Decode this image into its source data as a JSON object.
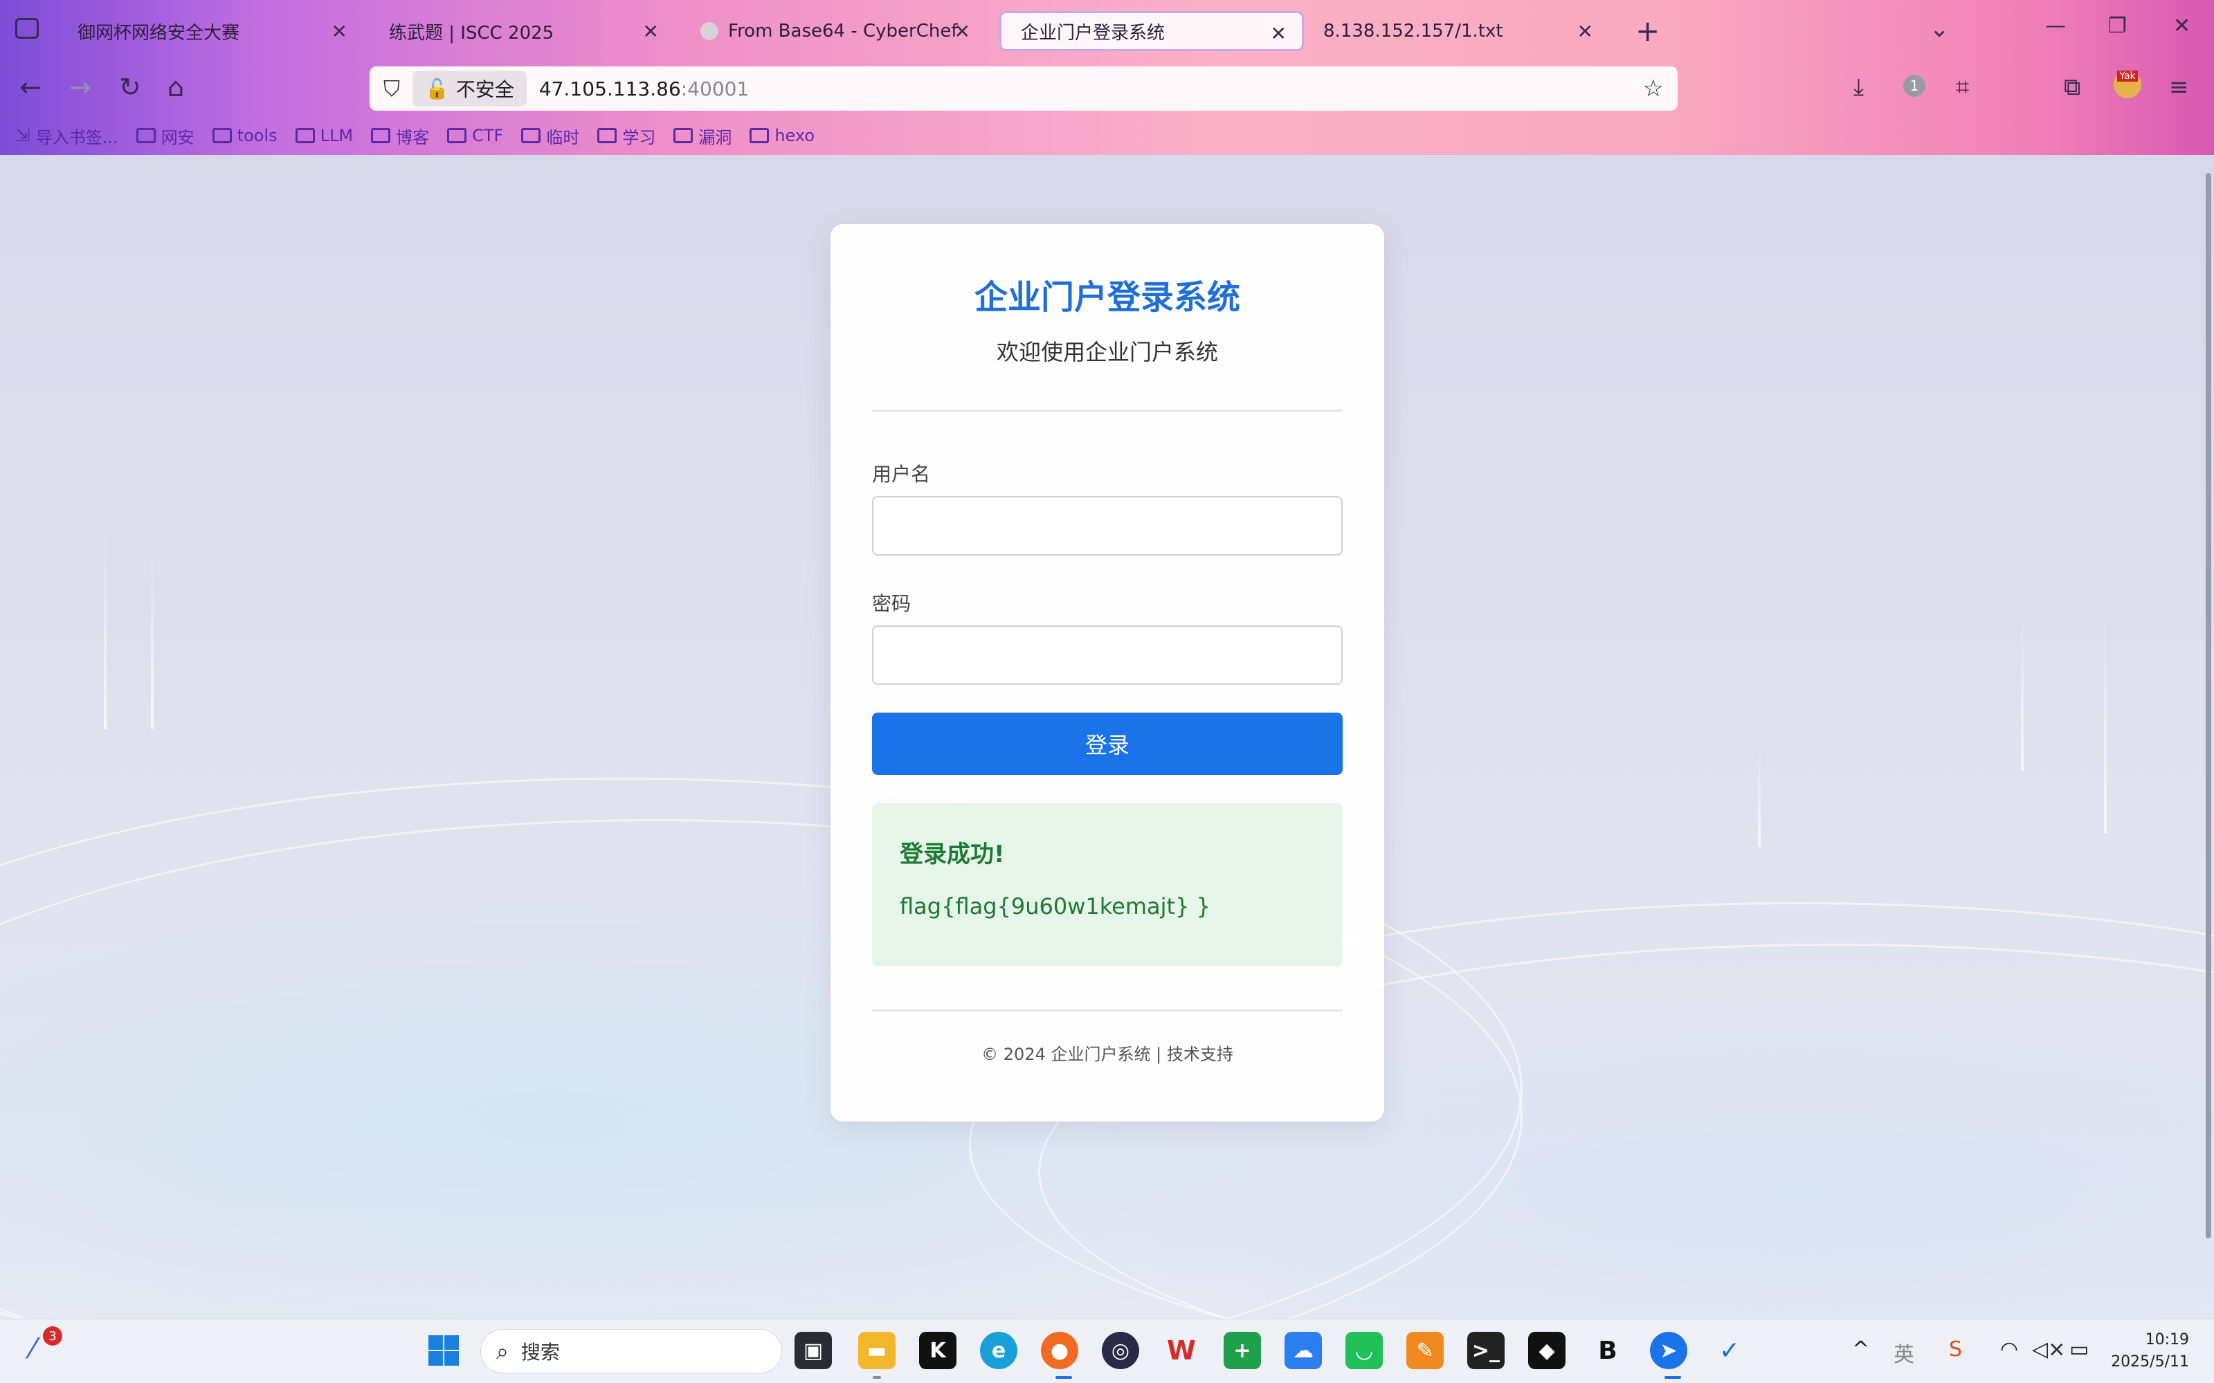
{
  "tabs": [
    {
      "label": "御网杯网络安全大赛"
    },
    {
      "label": "练武题 | ISCC 2025"
    },
    {
      "label": "From Base64 - CyberChef"
    },
    {
      "label": "企业门户登录系统"
    },
    {
      "label": "8.138.152.157/1.txt"
    }
  ],
  "address": {
    "security_label": "不安全",
    "host": "47.105.113.86",
    "port": ":40001"
  },
  "bookmarks": [
    "导入书签...",
    "网安",
    "tools",
    "LLM",
    "博客",
    "CTF",
    "临时",
    "学习",
    "漏洞",
    "hexo"
  ],
  "extension_badge": "1",
  "yak_badge": "Yak",
  "login": {
    "title": "企业门户登录系统",
    "subtitle": "欢迎使用企业门户系统",
    "username_label": "用户名",
    "username_value": "",
    "password_label": "密码",
    "password_value": "",
    "submit_label": "登录",
    "result_title": "登录成功!",
    "result_flag": "flag{flag{9u60w1kemajt} }",
    "footer": "© 2024 企业门户系统 | 技术支持"
  },
  "taskbar": {
    "search_placeholder": "搜索",
    "notification_count": "3",
    "ime_label": "英",
    "time": "10:19",
    "date": "2025/5/11"
  },
  "colors": {
    "accent": "#1a73e8",
    "title_blue": "#1f6fd6",
    "success_green": "#1d7a34",
    "success_bg": "#e7f4e9"
  }
}
